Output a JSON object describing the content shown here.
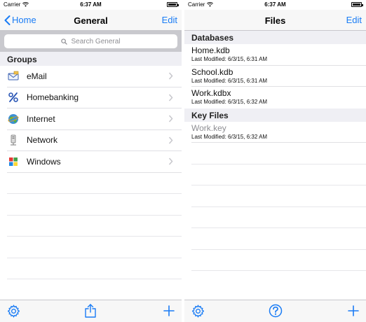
{
  "left": {
    "status": {
      "carrier": "Carrier",
      "time": "6:37 AM"
    },
    "nav": {
      "back_label": "Home",
      "title": "General",
      "edit_label": "Edit"
    },
    "search": {
      "placeholder": "Search General"
    },
    "groups_header": "Groups",
    "groups": [
      {
        "label": "eMail",
        "icon": "email-icon"
      },
      {
        "label": "Homebanking",
        "icon": "percent-icon"
      },
      {
        "label": "Internet",
        "icon": "globe-icon"
      },
      {
        "label": "Network",
        "icon": "network-icon"
      },
      {
        "label": "Windows",
        "icon": "windows-icon"
      }
    ],
    "toolbar": {
      "left_icon": "gear-icon",
      "center_icon": "share-icon",
      "right_icon": "plus-icon"
    }
  },
  "right": {
    "status": {
      "carrier": "Carrier",
      "time": "6:37 AM"
    },
    "nav": {
      "title": "Files",
      "edit_label": "Edit"
    },
    "databases_header": "Databases",
    "databases": [
      {
        "name": "Home.kdb",
        "modified": "Last Modified: 6/3/15, 6:31 AM"
      },
      {
        "name": "School.kdb",
        "modified": "Last Modified: 6/3/15, 6:31 AM"
      },
      {
        "name": "Work.kdbx",
        "modified": "Last Modified: 6/3/15, 6:32 AM"
      }
    ],
    "keyfiles_header": "Key Files",
    "keyfiles": [
      {
        "name": "Work.key",
        "modified": "Last Modified: 6/3/15, 6:32 AM"
      }
    ],
    "toolbar": {
      "left_icon": "gear-icon",
      "center_icon": "help-icon",
      "right_icon": "plus-icon"
    }
  },
  "colors": {
    "accent": "#1a7cf5",
    "section_bg": "#efeff4",
    "separator": "#e0e0e4"
  }
}
